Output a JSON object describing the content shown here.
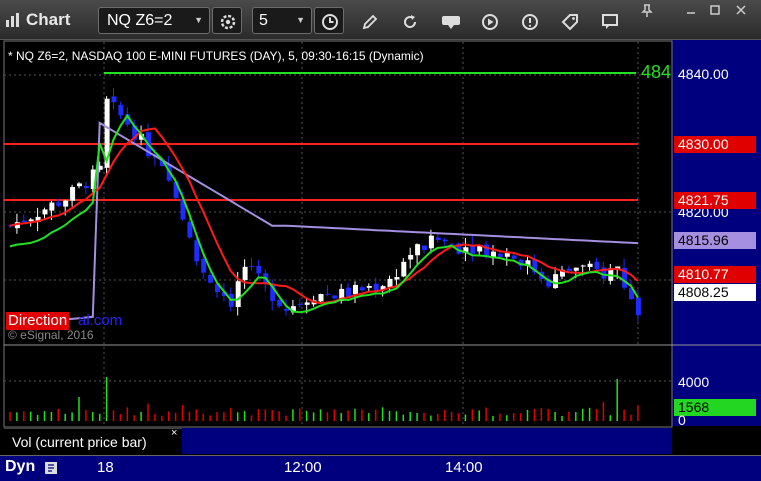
{
  "toolbar": {
    "title": "Chart",
    "symbol": "NQ Z6=2",
    "interval": "5",
    "icons": [
      "chart-icon",
      "settings-icon",
      "clock-icon",
      "pencil-icon",
      "refresh-icon",
      "get-icon",
      "play-icon",
      "tag-icon",
      "comment-icon",
      "pin-icon",
      "minimize-icon",
      "maximize-icon",
      "close-icon"
    ]
  },
  "chart": {
    "header": "* NQ Z6=2, NASDAQ 100 E-MINI FUTURES (DAY), 5, 09:30-16:15 (Dynamic)",
    "right_edge_label": "484",
    "price_axis": [
      "4840.00",
      "4820.00"
    ],
    "tags": {
      "level_high": "4830.00",
      "level_mid": "4821.75",
      "purple_ma": "4815.96",
      "red_ma": "4810.77",
      "last": "4808.25",
      "volume": "1568"
    },
    "volume_axis": [
      "4000",
      "0"
    ],
    "watermark_a": "Direction",
    "watermark_b": "al.com",
    "copyright": "© eSignal, 2016",
    "colors": {
      "up": "#ffffff",
      "down": "#1f2bff",
      "ma_red": "#ff1a1a",
      "ma_purple": "#a58fe0",
      "ma_green": "#22e022",
      "level": "#ff2020",
      "axis_bg": "#00007e"
    }
  },
  "volume_panel": {
    "label": "Vol (current price bar)",
    "close": "×"
  },
  "time_axis": {
    "mode": "Dyn",
    "labels": [
      "18",
      "12:00",
      "14:00"
    ]
  },
  "chart_data": {
    "type": "candlestick",
    "price_ylim": [
      4800,
      4845
    ],
    "horizontal_levels": [
      4841,
      4830.0,
      4821.75
    ],
    "last_price": 4808.25,
    "ma_values": {
      "purple": 4815.96,
      "red": 4810.77
    },
    "volume_ylim": [
      0,
      6000
    ],
    "last_volume": 1568,
    "x_labels": [
      "18",
      "12:00",
      "14:00"
    ]
  }
}
